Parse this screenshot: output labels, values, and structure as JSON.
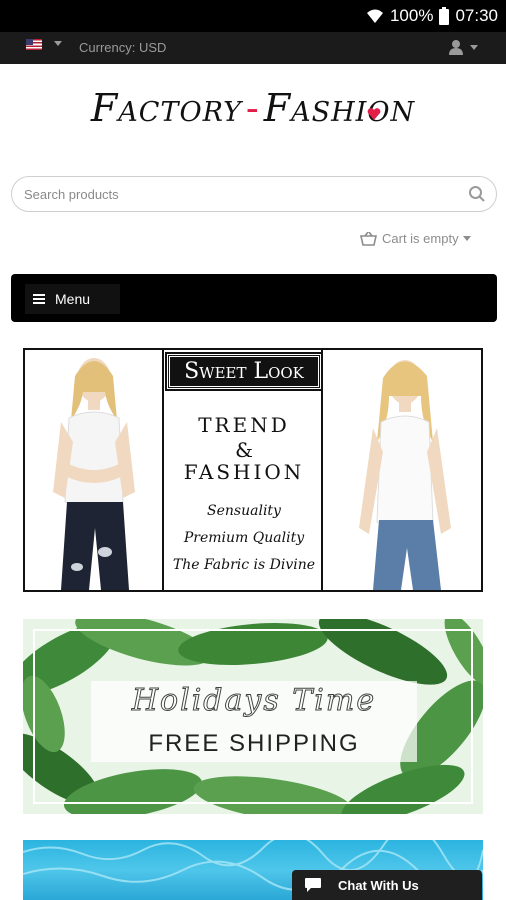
{
  "status_bar": {
    "battery": "100%",
    "time": "07:30",
    "icons": [
      "wifi-icon",
      "battery-icon"
    ]
  },
  "topbar": {
    "currency_label": "Currency: USD",
    "flag": "us-flag-icon",
    "account_icon": "user-icon"
  },
  "logo": {
    "part1": "Factory",
    "separator": "-",
    "part2": "Fashion"
  },
  "search": {
    "placeholder": "Search products",
    "value": ""
  },
  "cart": {
    "label": "Cart is empty"
  },
  "menu": {
    "label": "Menu"
  },
  "banner_sweet_look": {
    "heading": "Sweet Look",
    "line1": "TREND",
    "line2": "&",
    "line3": "FASHION",
    "tag1": "Sensuality",
    "tag2": "Premium Quality",
    "tag3": "The Fabric is Divine"
  },
  "banner_holidays": {
    "title": "Holidays Time",
    "subtitle": "FREE SHIPPING"
  },
  "chat": {
    "label": "Chat With Us"
  },
  "colors": {
    "header_bg": "#1b1b1b",
    "menu_bg": "#000000",
    "accent_heart": "#e11d48"
  }
}
